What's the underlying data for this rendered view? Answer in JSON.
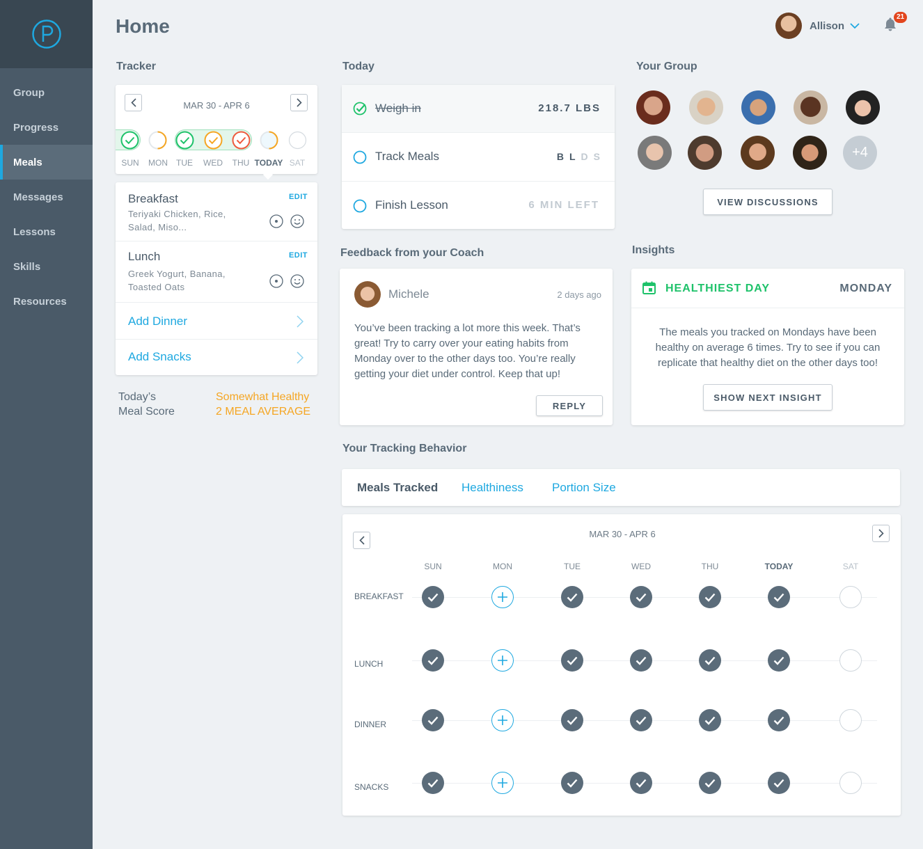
{
  "header": {
    "title": "Home",
    "user_name": "Allison",
    "notification_count": "21"
  },
  "sidebar": {
    "items": [
      {
        "label": "Group"
      },
      {
        "label": "Progress"
      },
      {
        "label": "Meals",
        "active": true
      },
      {
        "label": "Messages"
      },
      {
        "label": "Lessons"
      },
      {
        "label": "Skills"
      },
      {
        "label": "Resources"
      }
    ]
  },
  "tracker": {
    "title": "Tracker",
    "range": "MAR 30 - APR 6",
    "days": [
      {
        "label": "SUN",
        "status": "healthy"
      },
      {
        "label": "MON",
        "status": "partial"
      },
      {
        "label": "TUE",
        "status": "healthy"
      },
      {
        "label": "WED",
        "status": "somewhat"
      },
      {
        "label": "THU",
        "status": "unhealthy"
      },
      {
        "label": "TODAY",
        "status": "today"
      },
      {
        "label": "SAT",
        "status": "future"
      }
    ],
    "meals": [
      {
        "name": "Breakfast",
        "desc": "Teriyaki Chicken, Rice, Salad, Miso...",
        "edit": "EDIT"
      },
      {
        "name": "Lunch",
        "desc": "Greek Yogurt, Banana, Toasted Oats",
        "edit": "EDIT"
      }
    ],
    "add_dinner": "Add Dinner",
    "add_snacks": "Add Snacks",
    "score_label_1": "Today’s",
    "score_label_2": "Meal Score",
    "score_value": "Somewhat Healthy",
    "score_avg": "2 MEAL AVERAGE"
  },
  "today": {
    "title": "Today",
    "items": [
      {
        "label": "Weigh in",
        "value": "218.7 LBS",
        "done": true
      },
      {
        "label": "Track Meals",
        "value": "",
        "done": false
      },
      {
        "label": "Finish Lesson",
        "value": "6 MIN LEFT",
        "done": false
      }
    ],
    "meal_letters": [
      "B",
      "L",
      "D",
      "S"
    ]
  },
  "group": {
    "title": "Your Group",
    "more": "+4",
    "button": "VIEW DISCUSSIONS"
  },
  "feedback": {
    "title": "Feedback from your Coach",
    "coach": "Michele",
    "time": "2 days ago",
    "message": "You’ve been tracking a lot more this week. That’s great! Try to carry over your eating habits from Monday over to the other days too. You’re really getting your diet under control. Keep that up!",
    "reply": "REPLY"
  },
  "insights": {
    "title": "Insights",
    "label": "HEALTHIEST DAY",
    "day": "MONDAY",
    "text": "The meals you tracked on Mondays have been healthy on average 6 times. Try to see if you can replicate that healthy diet on the other days too!",
    "button": "SHOW NEXT INSIGHT"
  },
  "behavior": {
    "title": "Your Tracking Behavior",
    "tabs": [
      "Meals Tracked",
      "Healthiness",
      "Portion Size"
    ],
    "range": "MAR 30 - APR 6",
    "days": [
      "SUN",
      "MON",
      "TUE",
      "WED",
      "THU",
      "TODAY",
      "SAT"
    ],
    "rows": [
      {
        "label": "BREAKFAST",
        "cells": [
          "done",
          "add",
          "done",
          "done",
          "done",
          "done",
          "empty"
        ]
      },
      {
        "label": "LUNCH",
        "cells": [
          "done",
          "add",
          "done",
          "done",
          "done",
          "done",
          "empty"
        ]
      },
      {
        "label": "DINNER",
        "cells": [
          "done",
          "add",
          "done",
          "done",
          "done",
          "done",
          "empty"
        ]
      },
      {
        "label": "SNACKS",
        "cells": [
          "done",
          "add",
          "done",
          "done",
          "done",
          "done",
          "empty"
        ]
      }
    ]
  },
  "colors": {
    "accent": "#1ea8e0",
    "healthy": "#1ec26a",
    "somewhat": "#f5a623",
    "unhealthy": "#ee5a3d",
    "sidebar": "#4a5a68"
  }
}
